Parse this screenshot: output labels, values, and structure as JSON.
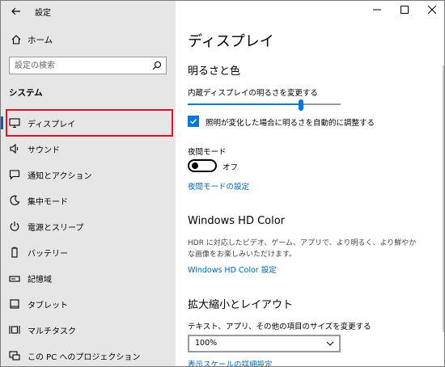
{
  "window": {
    "title": "設定"
  },
  "sidebar": {
    "home_label": "ホーム",
    "search_placeholder": "設定の検索",
    "section_title": "システム",
    "items": [
      {
        "label": "ディスプレイ",
        "icon": "monitor-icon",
        "selected": true
      },
      {
        "label": "サウンド",
        "icon": "speaker-icon"
      },
      {
        "label": "通知とアクション",
        "icon": "message-icon"
      },
      {
        "label": "集中モード",
        "icon": "moon-icon"
      },
      {
        "label": "電源とスリープ",
        "icon": "power-icon"
      },
      {
        "label": "バッテリー",
        "icon": "battery-icon"
      },
      {
        "label": "記憶域",
        "icon": "storage-icon"
      },
      {
        "label": "タブレット",
        "icon": "tablet-icon"
      },
      {
        "label": "マルチタスク",
        "icon": "multitask-icon"
      },
      {
        "label": "この PC へのプロジェクション",
        "icon": "projection-icon"
      }
    ]
  },
  "main": {
    "page_title": "ディスプレイ",
    "brightness_section": "明るさと色",
    "brightness_label": "内蔵ディスプレイの明るさを変更する",
    "brightness_level": 0.74,
    "auto_brightness_label": "照明が変化した場合に明るさを自動的に調整する",
    "auto_brightness_checked": true,
    "night_mode_label": "夜間モード",
    "night_mode_state": "オフ",
    "night_mode_link": "夜間モードの設定",
    "hd_color_title": "Windows HD Color",
    "hd_color_desc": "HDR に対応したビデオ、ゲーム、アプリで、より明るく、より鮮やかな画像をお楽しみいただけます。",
    "hd_color_link": "Windows HD Color 設定",
    "scale_section": "拡大縮小とレイアウト",
    "scale_label": "テキスト、アプリ、その他の項目のサイズを変更する",
    "scale_value": "100%",
    "scale_link": "表示スケールの詳細設定"
  },
  "colors": {
    "accent": "#0078d7",
    "sidebar_bg": "#e6e6e6",
    "highlight": "#e3121e"
  }
}
